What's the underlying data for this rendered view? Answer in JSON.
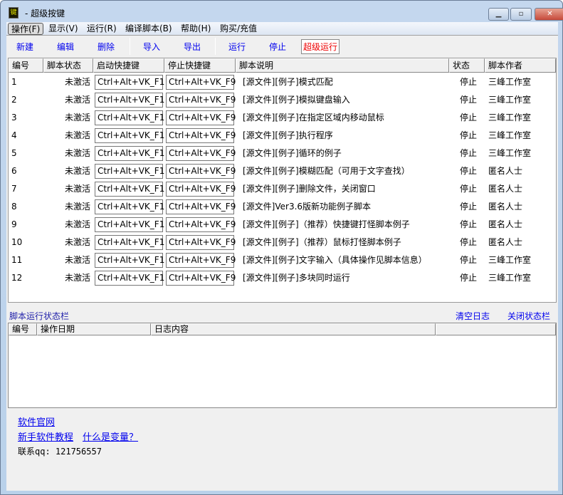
{
  "window": {
    "title": "- 超级按键",
    "icon_text": "键",
    "buttons": [
      "minimize",
      "maximize",
      "close"
    ]
  },
  "menu": [
    "操作(F)",
    "显示(V)",
    "运行(R)",
    "编译脚本(B)",
    "帮助(H)",
    "购买/充值"
  ],
  "toolbar": {
    "new": "新建",
    "edit": "编辑",
    "delete": "删除",
    "import": "导入",
    "export": "导出",
    "run": "运行",
    "stop": "停止",
    "super_run": "超级运行"
  },
  "columns": [
    "编号",
    "脚本状态",
    "启动快捷键",
    "停止快捷键",
    "脚本说明",
    "状态",
    "脚本作者"
  ],
  "rows": [
    {
      "id": "1",
      "state": "未激活",
      "start": "Ctrl+Alt+VK_F1",
      "stop": "Ctrl+Alt+VK_F9",
      "desc": "[源文件][例子]模式匹配",
      "status": "停止",
      "author": "三峰工作室"
    },
    {
      "id": "2",
      "state": "未激活",
      "start": "Ctrl+Alt+VK_F1",
      "stop": "Ctrl+Alt+VK_F9",
      "desc": "[源文件][例子]模拟键盘输入",
      "status": "停止",
      "author": "三峰工作室"
    },
    {
      "id": "3",
      "state": "未激活",
      "start": "Ctrl+Alt+VK_F1",
      "stop": "Ctrl+Alt+VK_F9",
      "desc": "[源文件][例子]在指定区域内移动鼠标",
      "status": "停止",
      "author": "三峰工作室"
    },
    {
      "id": "4",
      "state": "未激活",
      "start": "Ctrl+Alt+VK_F1",
      "stop": "Ctrl+Alt+VK_F9",
      "desc": "[源文件][例子]执行程序",
      "status": "停止",
      "author": "三峰工作室"
    },
    {
      "id": "5",
      "state": "未激活",
      "start": "Ctrl+Alt+VK_F1",
      "stop": "Ctrl+Alt+VK_F9",
      "desc": "[源文件][例子]循环的例子",
      "status": "停止",
      "author": "三峰工作室"
    },
    {
      "id": "6",
      "state": "未激活",
      "start": "Ctrl+Alt+VK_F1",
      "stop": "Ctrl+Alt+VK_F9",
      "desc": "[源文件][例子]模糊匹配（可用于文字查找）",
      "status": "停止",
      "author": "匿名人士"
    },
    {
      "id": "7",
      "state": "未激活",
      "start": "Ctrl+Alt+VK_F1",
      "stop": "Ctrl+Alt+VK_F9",
      "desc": "[源文件][例子]删除文件，关闭窗口",
      "status": "停止",
      "author": "匿名人士"
    },
    {
      "id": "8",
      "state": "未激活",
      "start": "Ctrl+Alt+VK_F1",
      "stop": "Ctrl+Alt+VK_F9",
      "desc": "[源文件]Ver3.6版新功能例子脚本",
      "status": "停止",
      "author": "匿名人士"
    },
    {
      "id": "9",
      "state": "未激活",
      "start": "Ctrl+Alt+VK_F1",
      "stop": "Ctrl+Alt+VK_F9",
      "desc": "[源文件][例子]（推荐）快捷键打怪脚本例子",
      "status": "停止",
      "author": "匿名人士"
    },
    {
      "id": "10",
      "state": "未激活",
      "start": "Ctrl+Alt+VK_F1",
      "stop": "Ctrl+Alt+VK_F9",
      "desc": "[源文件][例子]（推荐）鼠标打怪脚本例子",
      "status": "停止",
      "author": "匿名人士"
    },
    {
      "id": "11",
      "state": "未激活",
      "start": "Ctrl+Alt+VK_F1",
      "stop": "Ctrl+Alt+VK_F9",
      "desc": "[源文件][例子]文字输入（具体操作见脚本信息）",
      "status": "停止",
      "author": "三峰工作室"
    },
    {
      "id": "12",
      "state": "未激活",
      "start": "Ctrl+Alt+VK_F1",
      "stop": "Ctrl+Alt+VK_F9",
      "desc": "[源文件][例子]多块同时运行",
      "status": "停止",
      "author": "三峰工作室"
    }
  ],
  "statusbar": {
    "label": "脚本运行状态栏",
    "clear_log": "清空日志",
    "close_status": "关闭状态栏"
  },
  "log_columns": [
    "编号",
    "操作日期",
    "日志内容",
    ""
  ],
  "footer": {
    "website": "软件官网",
    "tutorial": "新手软件教程",
    "variable": "什么是变量？",
    "qq": "联系qq: 121756557"
  },
  "colors": {
    "link": "#0000ee",
    "super_run": "#ee0000"
  }
}
